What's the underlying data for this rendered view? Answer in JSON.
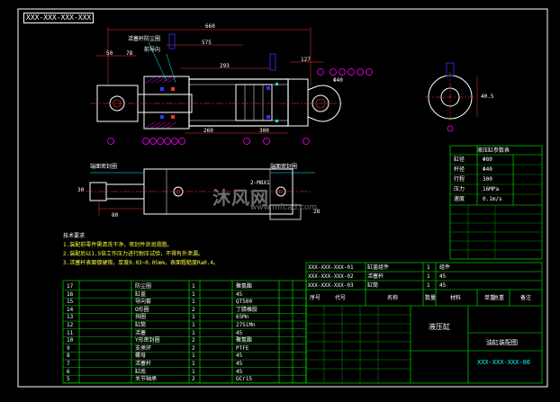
{
  "drawing_number_rotated": "XXX-XXX-XXX-XXX",
  "watermark": {
    "brand": "沐风网",
    "url": "www.mfcad.com"
  },
  "dimensions": {
    "overall": "660",
    "d575": "575",
    "d293": "293",
    "d50": "50",
    "d78": "78",
    "d127": "127",
    "d260": "260",
    "d300": "300",
    "phi40": "Φ40",
    "d30": "30",
    "side": "40.5",
    "d28": "28",
    "d80": "80"
  },
  "callouts": {
    "top1": "活塞杆防尘圈",
    "top2": "前导向",
    "side_left": "Φ40",
    "side_right": "Φ40",
    "lower_left": "端面密封圈",
    "lower_right": "端面密封圈",
    "lower_mid": "2-M8X1"
  },
  "balloons": [
    "1",
    "2",
    "3",
    "4",
    "5",
    "6",
    "7",
    "8",
    "9",
    "10",
    "11",
    "12",
    "13",
    "14",
    "15",
    "16"
  ],
  "notes": {
    "title": "技术要求",
    "items": [
      "1.装配前零件需清洗干净，密封件涂润滑脂。",
      "2.装配后以1.5倍工作压力进行耐压试验，不得有外泄漏。",
      "3.活塞杆表面镀硬铬，厚度0.03~0.05mm，表面粗糙度Ra0.4。"
    ]
  },
  "parts": [
    {
      "no": "17",
      "name": "防尘圈",
      "qty": "1",
      "mat": "聚氨酯"
    },
    {
      "no": "16",
      "name": "缸盖",
      "qty": "1",
      "mat": "45"
    },
    {
      "no": "15",
      "name": "导向套",
      "qty": "1",
      "mat": "QT500"
    },
    {
      "no": "14",
      "name": "O形圈",
      "qty": "2",
      "mat": "丁腈橡胶"
    },
    {
      "no": "13",
      "name": "挡圈",
      "qty": "1",
      "mat": "65Mn"
    },
    {
      "no": "12",
      "name": "缸筒",
      "qty": "1",
      "mat": "27SiMn"
    },
    {
      "no": "11",
      "name": "活塞",
      "qty": "1",
      "mat": "45"
    },
    {
      "no": "10",
      "name": "Y形密封圈",
      "qty": "2",
      "mat": "聚氨酯"
    },
    {
      "no": "9",
      "name": "支承环",
      "qty": "2",
      "mat": "PTFE"
    },
    {
      "no": "8",
      "name": "螺母",
      "qty": "1",
      "mat": "45"
    },
    {
      "no": "7",
      "name": "活塞杆",
      "qty": "1",
      "mat": "45"
    },
    {
      "no": "6",
      "name": "缸底",
      "qty": "1",
      "mat": "45"
    },
    {
      "no": "5",
      "name": "关节轴承",
      "qty": "2",
      "mat": "GCr15"
    }
  ],
  "header_row": {
    "c1": "序号",
    "c2": "代号",
    "c3": "名称",
    "c4": "数量",
    "c5": "材料",
    "c6": "单重",
    "c7": "总重",
    "c8": "备注"
  },
  "title_block": {
    "name": "液压缸",
    "name2": "油缸装配图",
    "code": "XXX-XXX-XXX-00"
  },
  "spec_table": {
    "title": "液压缸参数表",
    "rows": [
      {
        "k": "缸径",
        "v": "Φ80"
      },
      {
        "k": "杆径",
        "v": "Φ40"
      },
      {
        "k": "行程",
        "v": "300"
      },
      {
        "k": "压力",
        "v": "16MPa"
      },
      {
        "k": "速度",
        "v": "0.1m/s"
      }
    ]
  },
  "top_table": [
    {
      "a": "XXX-XXX-XXX-01",
      "b": "缸盖组件",
      "c": "1",
      "d": "组件"
    },
    {
      "a": "XXX-XXX-XXX-02",
      "b": "活塞杆",
      "c": "1",
      "d": "45"
    },
    {
      "a": "XXX-XXX-XXX-03",
      "b": "缸筒",
      "c": "1",
      "d": "45"
    }
  ]
}
